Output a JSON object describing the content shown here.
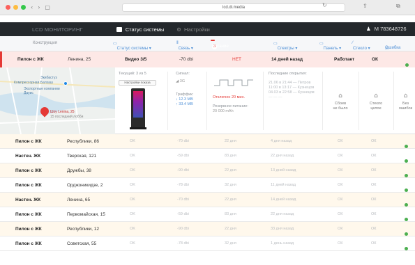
{
  "browser": {
    "nav_back": "‹",
    "nav_fwd": "›",
    "sidebar_icon": "▢",
    "url": "lcd.di.media",
    "reload": "↻",
    "share_icon": "share-icon",
    "share_glyph": "⇪",
    "tabs_glyph": "⧉"
  },
  "app": {
    "brand": "LCD МОНИТОРИНГ",
    "nav": [
      {
        "label": "Статус системы"
      },
      {
        "label": "Настройки"
      }
    ],
    "user": "М 783648726"
  },
  "filters": {
    "construction": "Конструкция",
    "status": "Статус системы ▾",
    "link": "Связь ▾",
    "power_count": "3",
    "power": "Питание",
    "screen": "Спектры ▾",
    "panel": "Панель ▾",
    "glass": "Стекло ▾",
    "errors": "Ошибка",
    "err_glyph": "⚠"
  },
  "alert_row": {
    "type": "Пилон с ЖК",
    "address": "Ленина, 25",
    "video": "Видео 3/5",
    "signal": "-70 dbi",
    "power": "НЕТ",
    "opened": "14 дней назад",
    "state": "Работает",
    "glass": "ОК",
    "indicator": "online"
  },
  "detail": {
    "map_labels": [
      "Экибастуз",
      "Компрессорная Балхаш",
      "Экспортные компании Дауис",
      "Шоу Lenina, 25",
      "15 последний лобби"
    ],
    "current_label": "Текущий: 3 из 5",
    "settings_btn": "Настройки показа",
    "signal_label": "Сигнал:",
    "signal_value": "3G",
    "traffic_label": "Траффик:",
    "traffic_down": "↓ 12.3 MB",
    "traffic_up": "↑ 33.4 MB",
    "disconnect": "Отключен 20 мин.",
    "battery_label": "Резервное питание:",
    "battery_value": "20 000 mAh",
    "last_open_title": "Последние открытия:",
    "last_open": [
      "21.06 в 21:44 — Петров",
      "11:00 в 13:17 — Кузнецов",
      "04.03 в 22:58 — Кузнецов",
      "— — —"
    ],
    "col_a_icon": "⌂",
    "col_a": [
      "Сбоев",
      "не было"
    ],
    "col_b_icon": "⌂",
    "col_b": [
      "Стекло",
      "целое"
    ],
    "col_c_icon": "⌂",
    "col_c": [
      "Без",
      "ошибок"
    ]
  },
  "rows": [
    {
      "type": "Пилон с ЖК",
      "address": "Республики, 86",
      "c1": "OK",
      "signal": "-70 dbi",
      "c3": "22 дня",
      "opened": "4 дня назад",
      "c5": "ОК",
      "c6": "ОК"
    },
    {
      "type": "Настен. ЖК",
      "address": "Тверская, 121",
      "c1": "OK",
      "signal": "-59 dbi",
      "c3": "83 дня",
      "opened": "22 дня назад",
      "c5": "ОК",
      "c6": "ОК"
    },
    {
      "type": "Пилон с ЖК",
      "address": "Дружбы, 38",
      "c1": "OK",
      "signal": "-90 dbi",
      "c3": "22 дня",
      "opened": "13 дней назад",
      "c5": "ОК",
      "c6": "ОК"
    },
    {
      "type": "Пилон с ЖК",
      "address": "Орджоникидзе, 2",
      "c1": "OK",
      "signal": "-78 dbi",
      "c3": "32 дня",
      "opened": "11 дней назад",
      "c5": "ОК",
      "c6": "ОК"
    },
    {
      "type": "Настен. ЖК",
      "address": "Ленина, 65",
      "c1": "OK",
      "signal": "-70 dbi",
      "c3": "22 дня",
      "opened": "14 дней назад",
      "c5": "ОК",
      "c6": "ОК"
    },
    {
      "type": "Пилон с ЖК",
      "address": "Первомайская, 15",
      "c1": "OK",
      "signal": "-59 dbi",
      "c3": "83 дня",
      "opened": "22 дня назад",
      "c5": "ОК",
      "c6": "ОК"
    },
    {
      "type": "Пилон с ЖК",
      "address": "Республики, 12",
      "c1": "OK",
      "signal": "-90 dbi",
      "c3": "22 дня",
      "opened": "33 дня назад",
      "c5": "ОК",
      "c6": "ОК"
    },
    {
      "type": "Пилон с ЖК",
      "address": "Советская, 55",
      "c1": "OK",
      "signal": "-78 dbi",
      "c3": "32 дня",
      "opened": "1 день назад",
      "c5": "ОК",
      "c6": "ОК"
    }
  ],
  "colors": {
    "accent_red": "#e53935",
    "online_green": "#4caf50",
    "header_dark": "#24282c"
  }
}
